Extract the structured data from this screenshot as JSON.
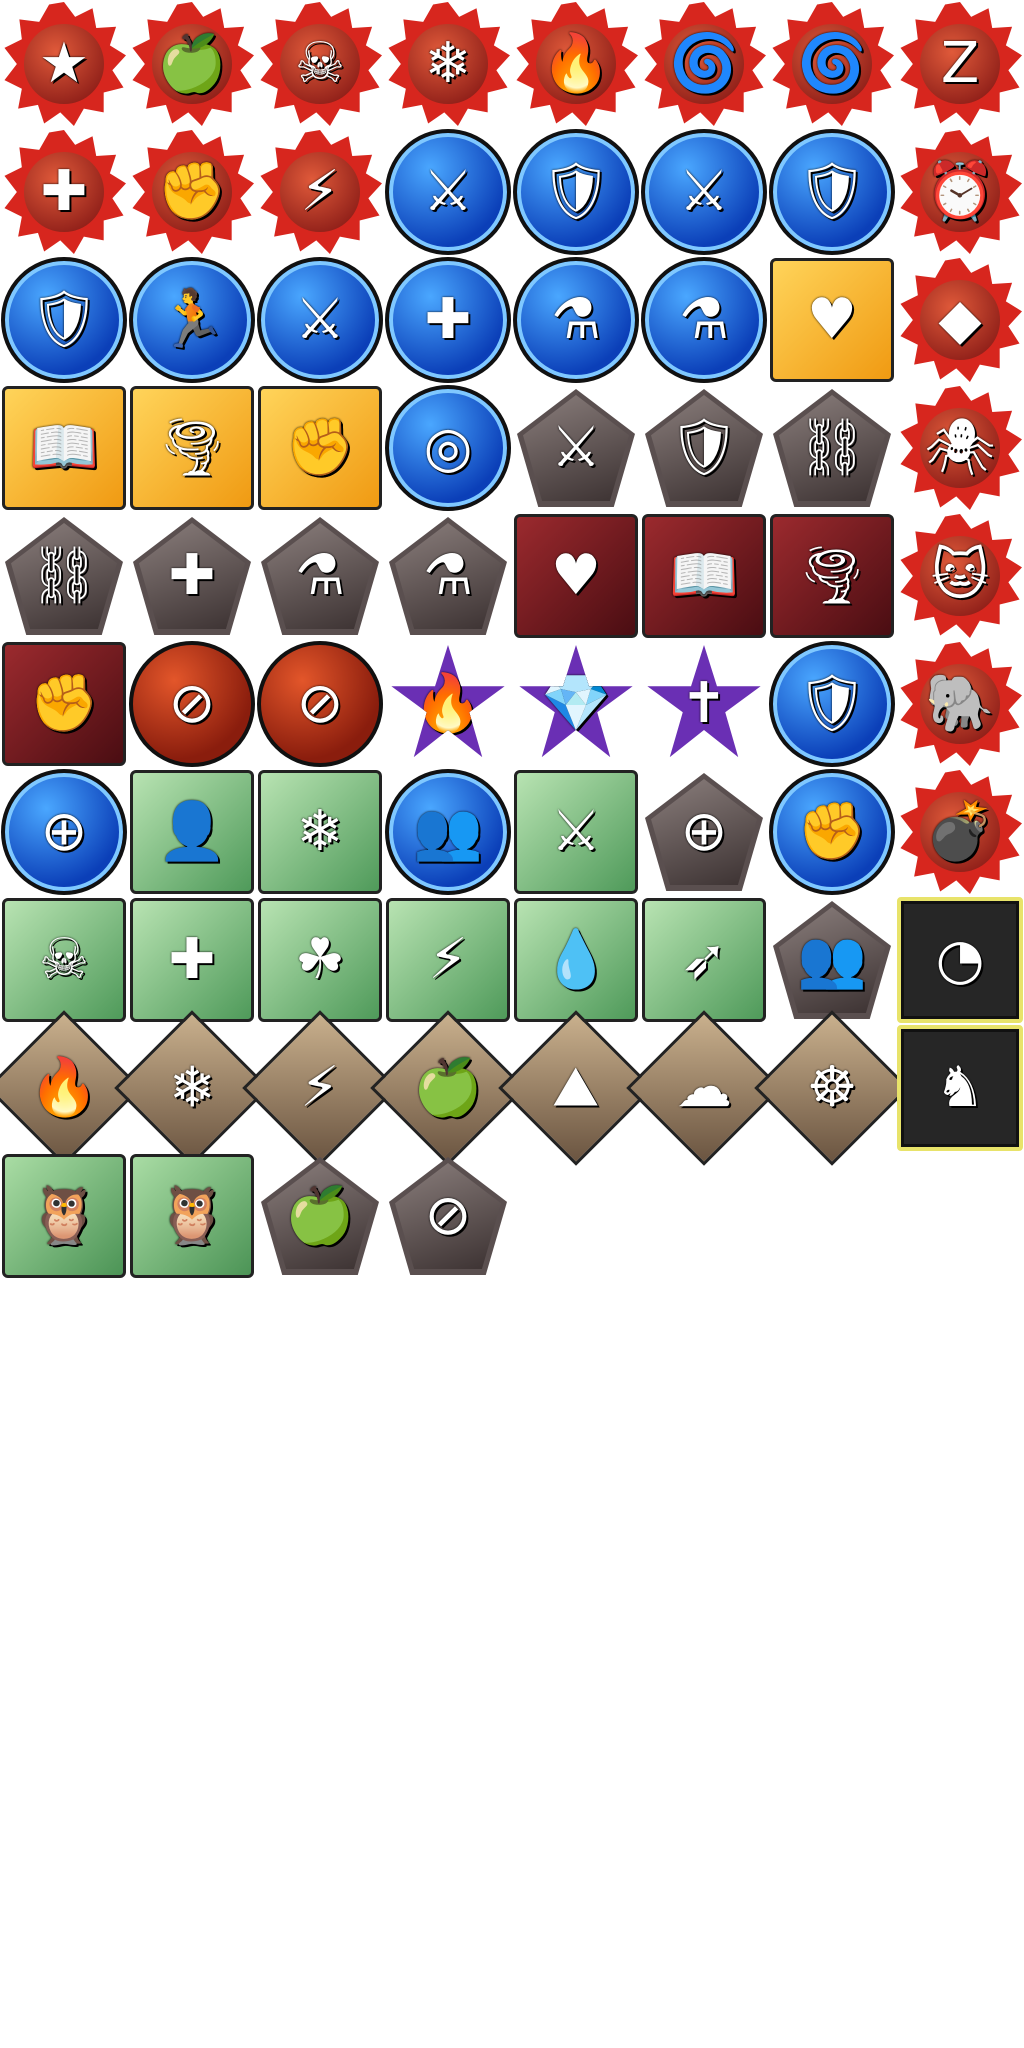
{
  "sheet": {
    "background": "#ffffff",
    "columns": 8,
    "icons": [
      {
        "icon": "stun-stars-icon",
        "frame": "star",
        "glyph": "★"
      },
      {
        "icon": "poison-apple-icon",
        "frame": "star",
        "glyph": "🍏"
      },
      {
        "icon": "skull-bandage-icon",
        "frame": "star",
        "glyph": "☠"
      },
      {
        "icon": "freeze-snowflake-icon",
        "frame": "star",
        "glyph": "❄"
      },
      {
        "icon": "burn-flame-icon",
        "frame": "star",
        "glyph": "🔥"
      },
      {
        "icon": "confusion-swirl-icon",
        "frame": "star",
        "glyph": "🌀"
      },
      {
        "icon": "vortex-spiral-icon",
        "frame": "star",
        "glyph": "🌀"
      },
      {
        "icon": "sleep-zzz-icon",
        "frame": "star",
        "glyph": "Z"
      },
      {
        "icon": "voodoo-doll-icon",
        "frame": "star",
        "glyph": "✚"
      },
      {
        "icon": "stone-fist-icon",
        "frame": "star",
        "glyph": "✊"
      },
      {
        "icon": "lightning-bolt-icon",
        "frame": "star",
        "glyph": "⚡"
      },
      {
        "icon": "attack-up-sword-icon",
        "frame": "circle",
        "glyph": "⚔"
      },
      {
        "icon": "fire-shield-icon",
        "frame": "circle",
        "glyph": "🛡"
      },
      {
        "icon": "sparkle-sword-icon",
        "frame": "circle",
        "glyph": "⚔"
      },
      {
        "icon": "sparkle-shield-icon",
        "frame": "circle",
        "glyph": "🛡"
      },
      {
        "icon": "clock-timer-icon",
        "frame": "star",
        "glyph": "⏰"
      },
      {
        "icon": "barrier-shield-icon",
        "frame": "circle",
        "glyph": "🛡"
      },
      {
        "icon": "haste-runner-icon",
        "frame": "circle",
        "glyph": "🏃"
      },
      {
        "icon": "crystal-sword-icon",
        "frame": "circle",
        "glyph": "⚔"
      },
      {
        "icon": "heal-cross-icon",
        "frame": "circle",
        "glyph": "✚"
      },
      {
        "icon": "red-potion-icon",
        "frame": "circle",
        "glyph": "⚗"
      },
      {
        "icon": "blue-potion-icon",
        "frame": "circle",
        "glyph": "⚗"
      },
      {
        "icon": "stitched-heart-icon",
        "frame": "orange",
        "glyph": "♥"
      },
      {
        "icon": "stone-block-icon",
        "frame": "star",
        "glyph": "◆"
      },
      {
        "icon": "open-book-icon",
        "frame": "orange",
        "glyph": "📖"
      },
      {
        "icon": "tornado-icon",
        "frame": "orange",
        "glyph": "🌪"
      },
      {
        "icon": "green-fist-icon",
        "frame": "orange",
        "glyph": "✊"
      },
      {
        "icon": "target-reticle-icon",
        "frame": "circle",
        "glyph": "◎"
      },
      {
        "icon": "gray-sword-icon",
        "frame": "pent",
        "glyph": "⚔"
      },
      {
        "icon": "gray-shield-icon",
        "frame": "pent",
        "glyph": "🛡"
      },
      {
        "icon": "shackled-foot-icon",
        "frame": "pent",
        "glyph": "⛓"
      },
      {
        "icon": "spider-icon",
        "frame": "star",
        "glyph": "🕷"
      },
      {
        "icon": "chained-sword-icon",
        "frame": "pent",
        "glyph": "⛓"
      },
      {
        "icon": "gray-cross-icon",
        "frame": "pent",
        "glyph": "✚"
      },
      {
        "icon": "empty-red-potion-icon",
        "frame": "pent",
        "glyph": "⚗"
      },
      {
        "icon": "empty-blue-potion-icon",
        "frame": "pent",
        "glyph": "⚗"
      },
      {
        "icon": "dark-stitched-heart-icon",
        "frame": "maroon",
        "glyph": "♥"
      },
      {
        "icon": "gray-book-icon",
        "frame": "maroon",
        "glyph": "📖"
      },
      {
        "icon": "gray-tornado-icon",
        "frame": "maroon",
        "glyph": "🌪"
      },
      {
        "icon": "cat-face-icon",
        "frame": "star",
        "glyph": "🐱"
      },
      {
        "icon": "gray-fist-icon",
        "frame": "maroon",
        "glyph": "✊"
      },
      {
        "icon": "no-sword-icon",
        "frame": "circle-red",
        "glyph": "⊘"
      },
      {
        "icon": "no-run-icon",
        "frame": "circle-red",
        "glyph": "⊘"
      },
      {
        "icon": "fire-torch-icon",
        "frame": "purple",
        "glyph": "🔥"
      },
      {
        "icon": "crystal-torch-icon",
        "frame": "purple",
        "glyph": "💎"
      },
      {
        "icon": "holy-cross-torch-icon",
        "frame": "purple",
        "glyph": "✝"
      },
      {
        "icon": "cracked-shield-icon",
        "frame": "circle",
        "glyph": "🛡"
      },
      {
        "icon": "elephant-face-icon",
        "frame": "star",
        "glyph": "🐘"
      },
      {
        "icon": "crosshair-orb-icon",
        "frame": "circle",
        "glyph": "⊕"
      },
      {
        "icon": "radiant-person-icon",
        "frame": "green",
        "glyph": "👤"
      },
      {
        "icon": "frozen-shield-icon",
        "frame": "green",
        "glyph": "❄"
      },
      {
        "icon": "group-people-icon",
        "frame": "circle",
        "glyph": "👥"
      },
      {
        "icon": "sword-shield-combo-icon",
        "frame": "green",
        "glyph": "⚔"
      },
      {
        "icon": "pent-crosshair-icon",
        "frame": "pent",
        "glyph": "⊕"
      },
      {
        "icon": "water-fist-icon",
        "frame": "circle",
        "glyph": "✊"
      },
      {
        "icon": "bomb-key-icon",
        "frame": "star",
        "glyph": "💣"
      },
      {
        "icon": "green-skull-icon",
        "frame": "green",
        "glyph": "☠"
      },
      {
        "icon": "golden-cross-icon",
        "frame": "green",
        "glyph": "✚"
      },
      {
        "icon": "four-leaf-clover-icon",
        "frame": "green",
        "glyph": "☘"
      },
      {
        "icon": "green-lightning-icon",
        "frame": "green",
        "glyph": "⚡"
      },
      {
        "icon": "water-drop-icon",
        "frame": "green",
        "glyph": "💧"
      },
      {
        "icon": "broken-arrow-icon",
        "frame": "green",
        "glyph": "➶"
      },
      {
        "icon": "gray-people-icon",
        "frame": "pent",
        "glyph": "👥"
      },
      {
        "icon": "pacman-speech-icon",
        "frame": "black",
        "glyph": "◔"
      },
      {
        "icon": "diamond-fire-icon",
        "frame": "diamond",
        "glyph": "🔥"
      },
      {
        "icon": "diamond-snowflake-icon",
        "frame": "diamond",
        "glyph": "❄"
      },
      {
        "icon": "diamond-lightning-icon",
        "frame": "diamond",
        "glyph": "⚡"
      },
      {
        "icon": "diamond-apple-icon",
        "frame": "diamond",
        "glyph": "🍏"
      },
      {
        "icon": "diamond-rock-icon",
        "frame": "diamond",
        "glyph": "⛰"
      },
      {
        "icon": "night-cloud-icon",
        "frame": "diamond",
        "glyph": "☁"
      },
      {
        "icon": "ship-wheel-icon",
        "frame": "diamond",
        "glyph": "☸"
      },
      {
        "icon": "rocking-horse-icon",
        "frame": "black",
        "glyph": "♞"
      },
      {
        "icon": "blue-owl-icon",
        "frame": "owl",
        "glyph": "🦉"
      },
      {
        "icon": "gray-owl-icon",
        "frame": "owl",
        "glyph": "🦉"
      },
      {
        "icon": "eaten-apple-icon",
        "frame": "pent",
        "glyph": "🍏"
      },
      {
        "icon": "no-shield-icon",
        "frame": "pent",
        "glyph": "⊘"
      }
    ]
  }
}
